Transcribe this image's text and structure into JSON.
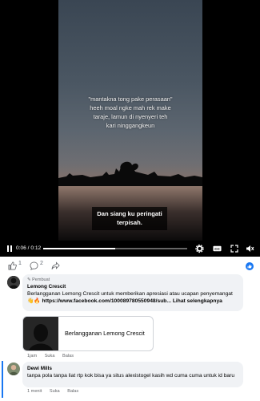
{
  "video": {
    "caption_lines": [
      "\"mantakna tong pake perasaan\"",
      "heeh moal ngke mah rek make",
      "taraje, lamun di nyenyeri teh",
      "kari ninggangkeun"
    ],
    "subtitle_lines": [
      "Dan siang ku peringati",
      "terpisah."
    ],
    "time": "0:06 / 0:12",
    "progress": 0.5
  },
  "reactions": {
    "likes": "1",
    "comments": "2"
  },
  "comments": [
    {
      "badge": "Pembuat",
      "author": "Lemong Crescit",
      "text": "Berlangganan Lemong Crescit untuk memberikan apresiasi atau ucapan penyemangat 👋🔥",
      "link": "https://www.facebook.com/100089780550948/sub...",
      "more": "Lihat selengkapnya",
      "card_title": "Berlangganan Lemong Crescit",
      "time": "1jam",
      "like": "Suka",
      "reply": "Balas"
    },
    {
      "author": "Dewi Mills",
      "text": "tanpa pola tanpa liat rtp kok bisa ya situs alexistogel kasih wd cuma cuma untuk id baru",
      "time": "1 menit",
      "like": "Suka",
      "reply": "Balas"
    }
  ],
  "colors": {
    "accent": "#1877f2",
    "bubble": "#f0f2f5"
  }
}
